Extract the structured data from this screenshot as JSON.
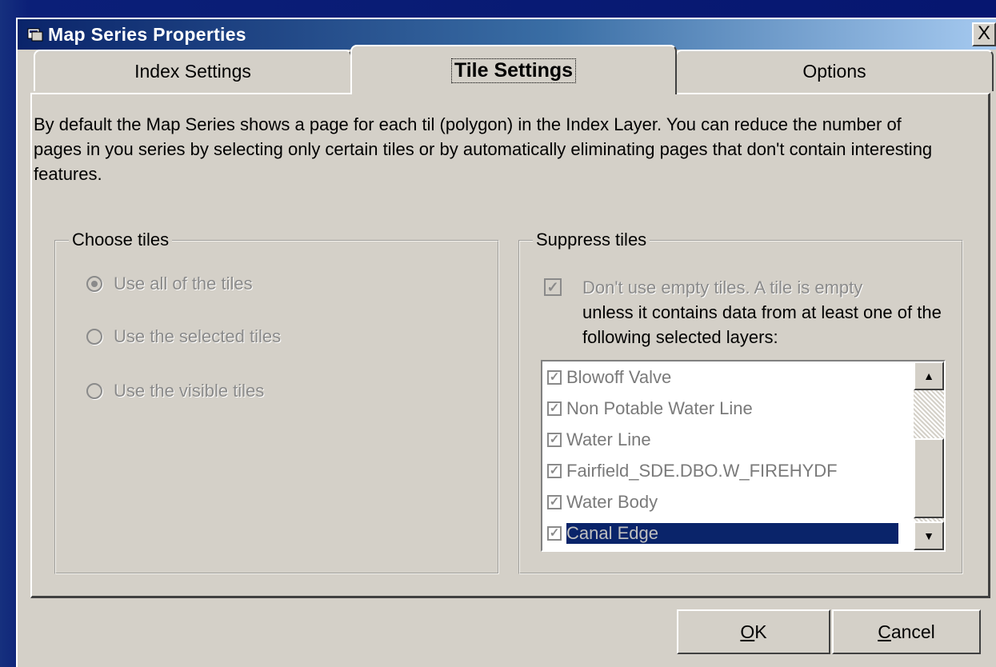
{
  "window": {
    "title": "Map Series Properties",
    "close_glyph": "X"
  },
  "tabs": [
    {
      "label": "Index Settings",
      "active": false
    },
    {
      "label": "Tile Settings",
      "active": true
    },
    {
      "label": "Options",
      "active": false
    }
  ],
  "description": "By default the Map Series shows a page for each til (polygon) in the Index Layer.  You can reduce the number of pages in you series by selecting only certain tiles or by automatically eliminating pages that don't contain interesting features.",
  "choose_tiles": {
    "label": "Choose tiles",
    "options": [
      {
        "label": "Use all of the tiles",
        "checked": true
      },
      {
        "label": "Use the selected tiles",
        "checked": false
      },
      {
        "label": "Use the visible tiles",
        "checked": false
      }
    ]
  },
  "suppress_tiles": {
    "label": "Suppress tiles",
    "checkbox_text_disabled": "Don't use empty tiles.  A tile is empty",
    "checkbox_text": "unless it contains data from at least one of the following selected layers:",
    "checkbox_checked": true,
    "layers": [
      {
        "label": "Blowoff Valve",
        "checked": true,
        "selected": false
      },
      {
        "label": "Non Potable Water Line",
        "checked": true,
        "selected": false
      },
      {
        "label": "Water Line",
        "checked": true,
        "selected": false
      },
      {
        "label": "Fairfield_SDE.DBO.W_FIREHYDF",
        "checked": true,
        "selected": false
      },
      {
        "label": "Water Body",
        "checked": true,
        "selected": false
      },
      {
        "label": "Canal Edge",
        "checked": true,
        "selected": true
      }
    ]
  },
  "buttons": {
    "ok_underlined": "O",
    "ok_rest": "K",
    "cancel_underlined": "C",
    "cancel_rest": "ancel"
  }
}
